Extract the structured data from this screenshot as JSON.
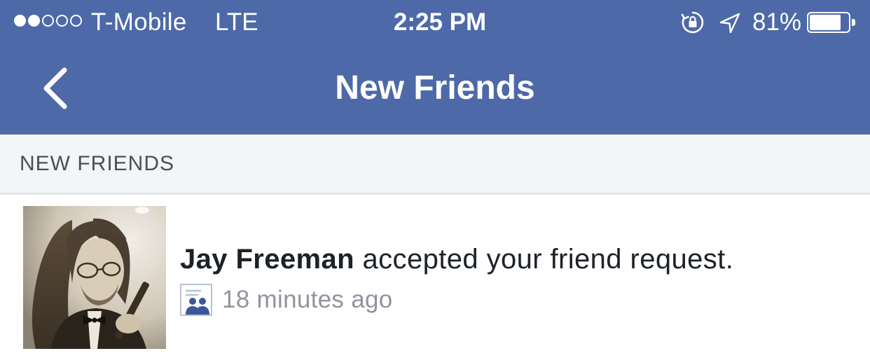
{
  "status_bar": {
    "signal_strength": 2,
    "signal_max": 5,
    "carrier": "T-Mobile",
    "network": "LTE",
    "time": "2:25 PM",
    "icons": [
      "rotation-lock-icon",
      "location-arrow-icon",
      "battery-icon"
    ],
    "battery_percent_text": "81%",
    "battery_level": 0.81
  },
  "nav": {
    "back_icon": "chevron-left-icon",
    "title": "New Friends"
  },
  "section": {
    "title": "NEW FRIENDS"
  },
  "notifications": [
    {
      "avatar": "avatar-photo",
      "name": "Jay Freeman",
      "message": "accepted your friend request.",
      "icon": "friends-icon",
      "time": "18 minutes ago"
    }
  ],
  "colors": {
    "brand_blue": "#4d69a8",
    "section_bg": "#f4f5f7",
    "text_dark": "#1d2129",
    "text_muted": "#90949c",
    "friends_icon_blue": "#3b5998"
  }
}
